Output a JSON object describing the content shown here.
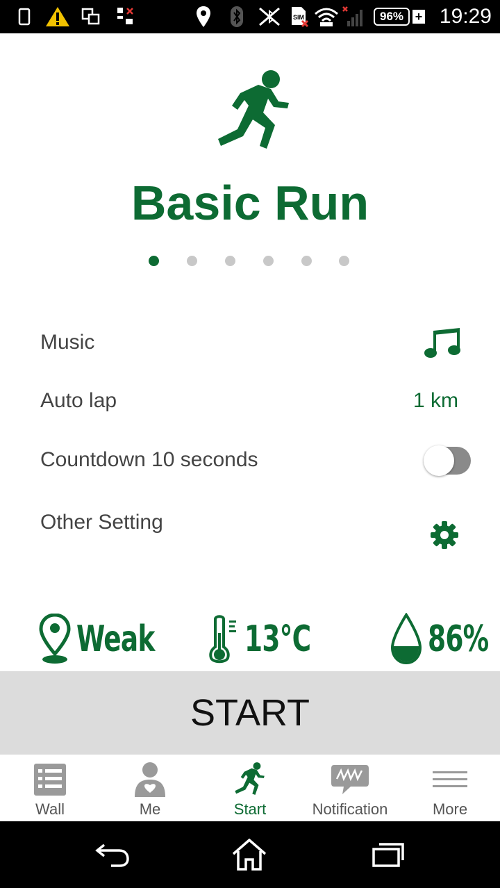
{
  "status_bar": {
    "battery_percent": "96%",
    "battery_plus": "+",
    "time": "19:29",
    "icons": [
      "phone-icon",
      "warning-icon",
      "screens-icon",
      "data-icon",
      "location-icon",
      "bluetooth-icon",
      "nfc-icon",
      "sim-icon",
      "wifi-icon",
      "signal-icon"
    ]
  },
  "workout": {
    "title": "Basic Run",
    "icon": "runner-icon",
    "page_count": 6,
    "active_page": 0
  },
  "settings": {
    "music_label": "Music",
    "music_icon": "music-note-icon",
    "auto_lap_label": "Auto lap",
    "auto_lap_value": "1 km",
    "countdown_label": "Countdown 10 seconds",
    "countdown_enabled": false,
    "other_label": "Other Setting",
    "other_icon": "gear-icon"
  },
  "conditions": {
    "gps": "Weak",
    "temperature": "13°C",
    "humidity": "86%"
  },
  "start_label": "START",
  "tabs": [
    {
      "label": "Wall",
      "icon": "wall-icon"
    },
    {
      "label": "Me",
      "icon": "person-icon"
    },
    {
      "label": "Start",
      "icon": "runner-icon",
      "active": true
    },
    {
      "label": "Notification",
      "icon": "notification-icon"
    },
    {
      "label": "More",
      "icon": "menu-icon"
    }
  ],
  "colors": {
    "accent": "#0d6b33",
    "start_button_bg": "#dcdcdc"
  }
}
